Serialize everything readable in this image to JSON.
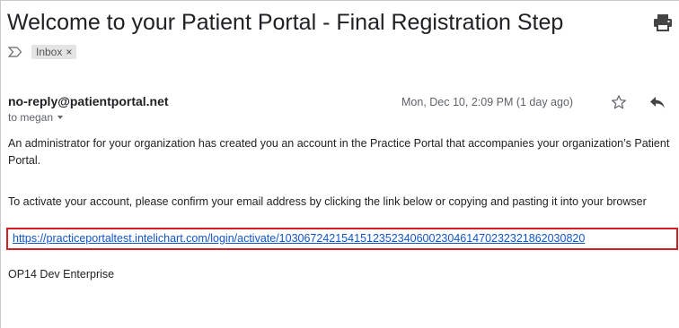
{
  "email": {
    "subject": "Welcome to your Patient Portal - Final Registration Step",
    "labels": [
      {
        "name": "Inbox",
        "remove_glyph": "×"
      }
    ],
    "sender": "no-reply@patientportal.net",
    "recipient": "to megan",
    "date": "Mon, Dec 10, 2:09 PM (1 day ago)",
    "body": {
      "paragraph1": "An administrator for your organization has created you an account in the Practice Portal that accompanies your organization’s Patient Portal.",
      "paragraph2": "To activate your account, please confirm your email address by clicking the link below or copying and pasting it into your browser",
      "link": "https://practiceportaltest.intelichart.com/login/activate/1030672421541512352340600230461470232321862030820",
      "signature": "OP14 Dev Enterprise"
    }
  },
  "icons": {
    "print": "print-icon",
    "important": "important-marker-icon",
    "star": "star-icon",
    "reply": "reply-icon",
    "recipient_details": "chevron-down-icon"
  },
  "colors": {
    "link": "#1155cc",
    "highlight_border": "#d31f26",
    "label_chip_bg": "#e4e4e4"
  }
}
